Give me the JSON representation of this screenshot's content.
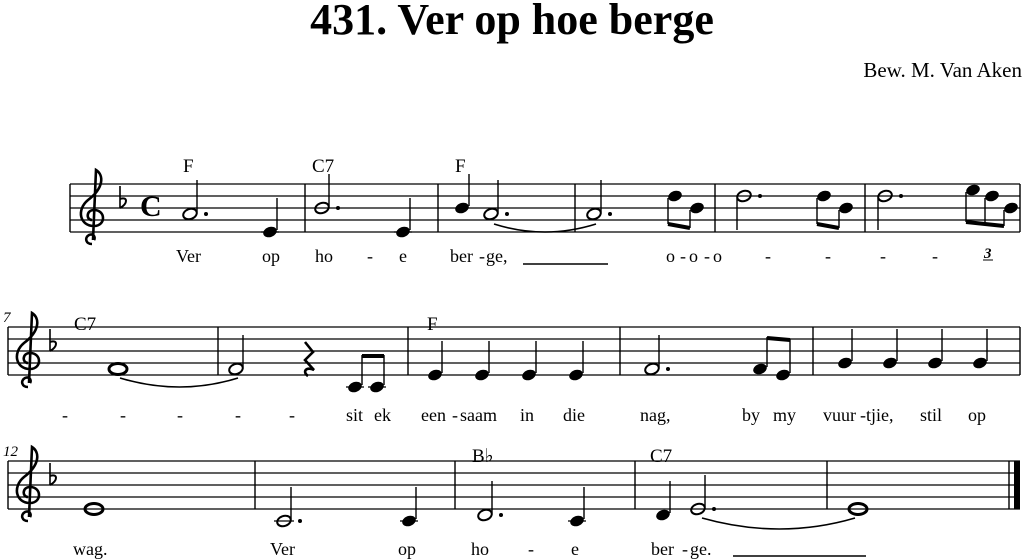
{
  "song": {
    "title": "431. Ver op hoe berge",
    "composer": "Bew. M. Van Aken",
    "time_signature": "C",
    "key_signature": "F major (one flat)"
  },
  "chords": [
    {
      "system": 1,
      "measure": 1,
      "label": "F"
    },
    {
      "system": 1,
      "measure": 2,
      "label": "C7"
    },
    {
      "system": 1,
      "measure": 3,
      "label": "F"
    },
    {
      "system": 2,
      "measure": 1,
      "label": "C7"
    },
    {
      "system": 2,
      "measure": 3,
      "label": "F"
    },
    {
      "system": 3,
      "measure": 3,
      "label": "B♭"
    },
    {
      "system": 3,
      "measure": 4,
      "label": "C7"
    }
  ],
  "measure_numbers": [
    "7",
    "12"
  ],
  "tuplet_label": "3",
  "lyrics": {
    "system1": [
      "Ver",
      "op",
      "ho",
      "-",
      "e",
      "ber",
      "-",
      "ge,",
      "o",
      "-",
      "o",
      "-",
      "o",
      "-",
      "-",
      "-",
      "-"
    ],
    "system2": [
      "-",
      "-",
      "-",
      "-",
      "-",
      "sit",
      "ek",
      "een",
      "-",
      "saam",
      "in",
      "die",
      "nag,",
      "by",
      "my",
      "vuur",
      "-",
      "tjie,",
      "stil",
      "op"
    ],
    "system3": [
      "wag.",
      "Ver",
      "op",
      "ho",
      "-",
      "e",
      "ber",
      "-",
      "ge."
    ]
  }
}
